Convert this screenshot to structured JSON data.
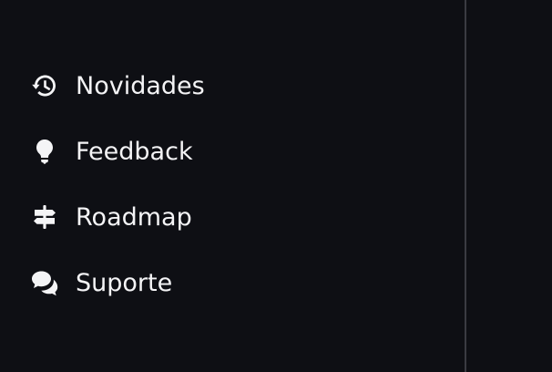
{
  "sidebar": {
    "items": [
      {
        "label": "Novidades",
        "icon": "history-icon"
      },
      {
        "label": "Feedback",
        "icon": "lightbulb-icon"
      },
      {
        "label": "Roadmap",
        "icon": "signpost-icon"
      },
      {
        "label": "Suporte",
        "icon": "chat-bubbles-icon"
      }
    ]
  },
  "colors": {
    "background": "#0e0f14",
    "text": "#f4f4f6",
    "divider": "#3a3b42"
  }
}
